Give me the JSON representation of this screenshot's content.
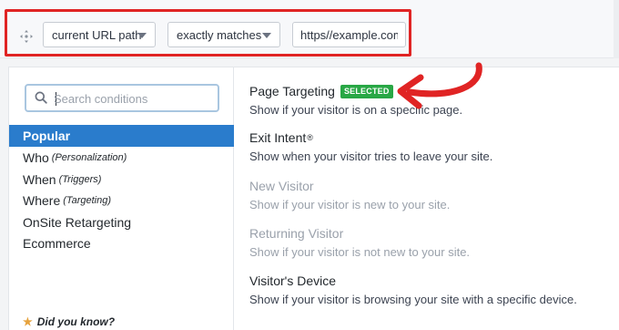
{
  "rule": {
    "field_select": "current URL path",
    "operator_select": "exactly matches",
    "value_input": "https//example.com/t"
  },
  "search": {
    "placeholder": "Search conditions"
  },
  "categories": [
    {
      "label": "Popular",
      "sub": ""
    },
    {
      "label": "Who",
      "sub": "(Personalization)"
    },
    {
      "label": "When",
      "sub": "(Triggers)"
    },
    {
      "label": "Where",
      "sub": "(Targeting)"
    },
    {
      "label": "OnSite Retargeting",
      "sub": ""
    },
    {
      "label": "Ecommerce",
      "sub": ""
    }
  ],
  "tip": {
    "label": "Did you know?"
  },
  "conditions": [
    {
      "title": "Page Targeting",
      "badge": "SELECTED",
      "desc": "Show if your visitor is on a specific page."
    },
    {
      "title": "Exit Intent",
      "sup": "®",
      "desc": "Show when your visitor tries to leave your site."
    },
    {
      "title": "New Visitor",
      "desc": "Show if your visitor is new to your site."
    },
    {
      "title": "Returning Visitor",
      "desc": "Show if your visitor is not new to your site."
    },
    {
      "title": "Visitor's Device",
      "desc": "Show if your visitor is browsing your site with a specific device."
    }
  ],
  "colors": {
    "highlight": "#e02424",
    "active_category": "#2a7ccc",
    "selected_badge": "#28a745",
    "tip_star": "#e6a23c"
  },
  "icons": [
    "move-icon",
    "search-icon",
    "star-icon",
    "chevron-down-icon",
    "annotation-arrow-icon"
  ]
}
